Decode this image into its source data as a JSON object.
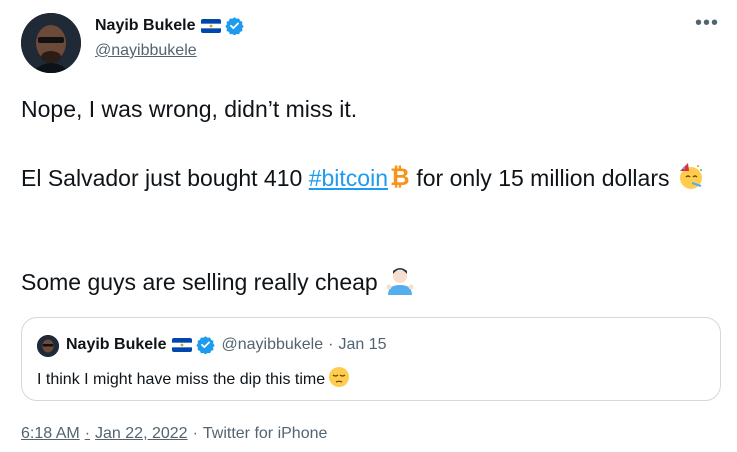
{
  "author": {
    "name": "Nayib Bukele",
    "handle": "@nayibbukele",
    "more_label": "•••"
  },
  "tweet": {
    "line1": "Nope, I was wrong, didn’t miss it.",
    "line2_pre": "El Salvador just bought 410 ",
    "hashtag": "#bitcoin",
    "line2_post": "  for only 15 million dollars ",
    "line3": "Some guys are selling really cheap "
  },
  "quote": {
    "name": "Nayib Bukele",
    "handle": "@nayibbukele",
    "separator": "·",
    "date": "Jan 15",
    "text": "I think I might have miss the dip this time "
  },
  "footer": {
    "time": "6:18 AM",
    "separator": "·",
    "date": "Jan 22, 2022",
    "source_separator": "·",
    "source": "Twitter for iPhone"
  },
  "colors": {
    "link": "#1d9bf0",
    "muted": "#536471",
    "text": "#0f1419",
    "border": "#cfd9de",
    "verified": "#1d9bf0",
    "bitcoin": "#f7931a"
  }
}
